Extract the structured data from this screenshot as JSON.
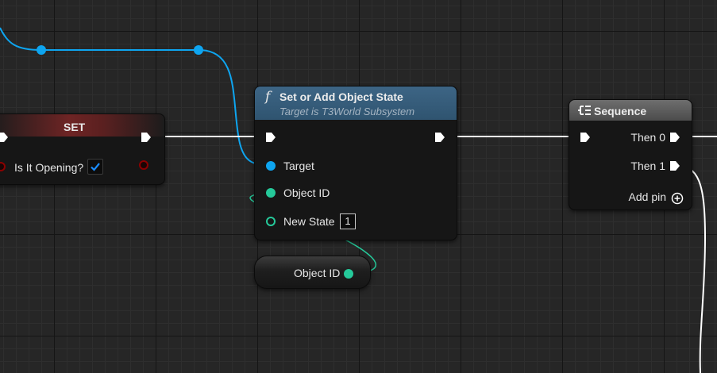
{
  "set_node": {
    "title": "SET",
    "header_color": "#9c2f2f",
    "pin_label": "Is It Opening?",
    "checkbox_checked": true,
    "pin_color": "#8c0000"
  },
  "function_node": {
    "icon": "f",
    "title": "Set or Add Object State",
    "subtitle": "Target is T3World Subsystem",
    "header_color": "#2f5470",
    "pins": {
      "target": "Target",
      "object_id": "Object ID",
      "new_state": "New State"
    },
    "new_state_value": "1"
  },
  "sequence_node": {
    "icon": "sequence-icon",
    "title": "Sequence",
    "header_color": "#5c5c5c",
    "outputs": [
      "Then 0",
      "Then 1"
    ],
    "add_pin_label": "Add pin"
  },
  "variable_node": {
    "label": "Object ID"
  },
  "colors": {
    "object_wire": "#0ea5f0",
    "struct_wire": "#25c99a",
    "exec_wire": "#ffffff"
  }
}
